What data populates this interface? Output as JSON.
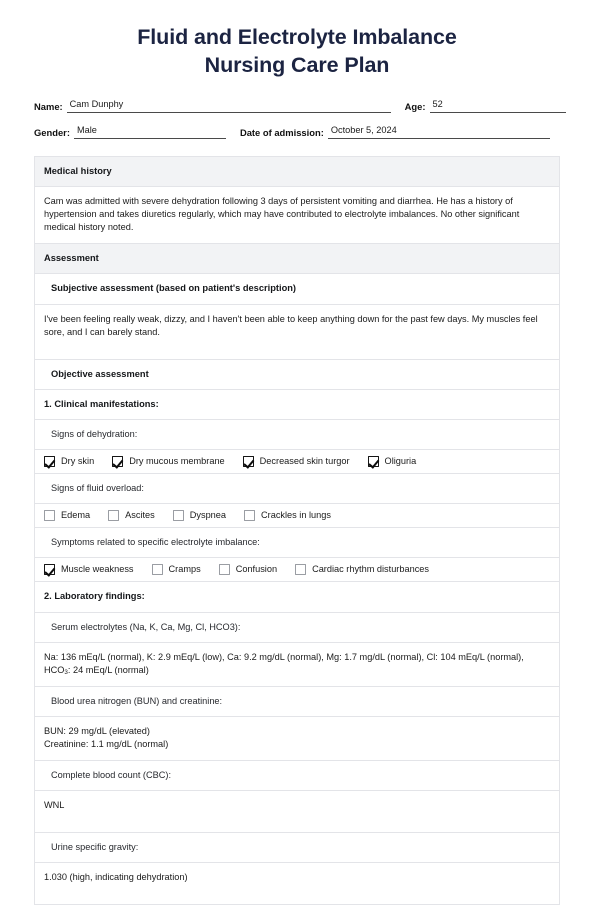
{
  "title": {
    "line1": "Fluid and Electrolyte Imbalance",
    "line2": "Nursing Care Plan",
    "color": "#1c2442"
  },
  "patient": {
    "name_label": "Name:",
    "name_value": "Cam Dunphy",
    "age_label": "Age:",
    "age_value": "52",
    "gender_label": "Gender:",
    "gender_value": "Male",
    "admission_label": "Date of admission:",
    "admission_value": "October 5, 2024"
  },
  "medical_history": {
    "header": "Medical history",
    "text": "Cam was admitted with severe dehydration following 3 days of persistent vomiting and diarrhea. He has a history of hypertension and takes diuretics regularly, which may have contributed to electrolyte imbalances. No other significant medical history noted."
  },
  "assessment": {
    "header": "Assessment",
    "subjective": {
      "header": "Subjective assessment (based on patient's description)",
      "text": "I've been feeling really weak, dizzy, and I haven't been able to keep anything down for the past few days. My muscles feel sore, and I can barely stand."
    },
    "objective": {
      "header": "Objective assessment",
      "clinical_manifestations": {
        "header": "1. Clinical manifestations:",
        "dehydration_label": "Signs of dehydration:",
        "dehydration_items": [
          {
            "label": "Dry skin",
            "checked": true
          },
          {
            "label": "Dry mucous membrane",
            "checked": true
          },
          {
            "label": "Decreased skin turgor",
            "checked": true
          },
          {
            "label": "Oliguria",
            "checked": true
          }
        ],
        "fluid_overload_label": "Signs of fluid overload:",
        "fluid_overload_items": [
          {
            "label": "Edema",
            "checked": false
          },
          {
            "label": "Ascites",
            "checked": false
          },
          {
            "label": "Dyspnea",
            "checked": false
          },
          {
            "label": "Crackles in lungs",
            "checked": false
          }
        ],
        "electrolyte_symptoms_label": "Symptoms related to specific electrolyte imbalance:",
        "electrolyte_symptoms_items": [
          {
            "label": "Muscle weakness",
            "checked": true
          },
          {
            "label": "Cramps",
            "checked": false
          },
          {
            "label": "Confusion",
            "checked": false
          },
          {
            "label": "Cardiac rhythm disturbances",
            "checked": false
          }
        ]
      },
      "laboratory_findings": {
        "header": "2. Laboratory findings:",
        "serum_label": "Serum electrolytes (Na, K, Ca, Mg, Cl, HCO3):",
        "serum_value_part1": "Na: 136 mEq/L (normal), K: 2.9 mEq/L (low), Ca: 9.2 mg/dL (normal), Mg: 1.7 mg/dL (normal), Cl: 104 mEq/L (normal), HCO",
        "serum_value_sub": "3",
        "serum_value_part2": ": 24 mEq/L (normal)",
        "bun_label": "Blood urea nitrogen (BUN) and creatinine:",
        "bun_value_line1": "BUN: 29 mg/dL (elevated)",
        "bun_value_line2": "Creatinine: 1.1 mg/dL (normal)",
        "cbc_label": "Complete blood count (CBC):",
        "cbc_value": "WNL",
        "urine_label": "Urine specific gravity:",
        "urine_value": "1.030 (high, indicating dehydration)"
      }
    }
  }
}
